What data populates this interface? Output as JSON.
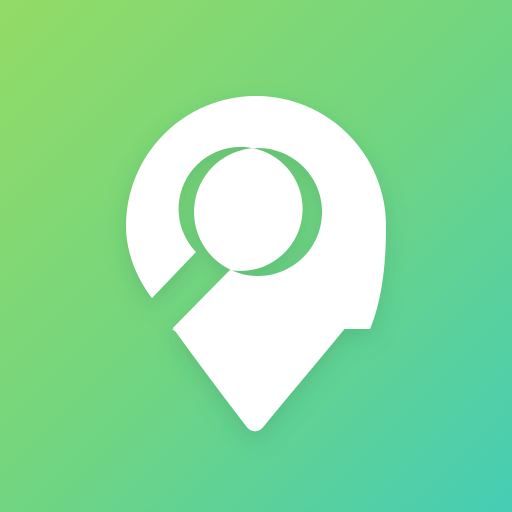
{
  "icon": {
    "semantic": "location-search-pin-icon",
    "gradient": {
      "start_color": "#93DB66",
      "mid_color": "#72D580",
      "end_color": "#45CDB5"
    },
    "pin_color": "#FFFFFF",
    "shadow_color": "#2E8A5A"
  }
}
